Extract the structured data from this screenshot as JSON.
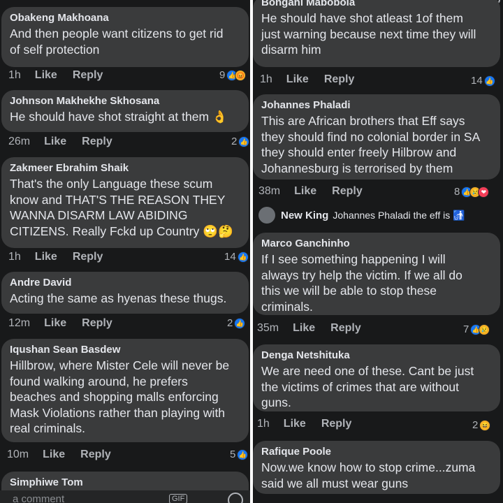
{
  "left": {
    "comments": [
      {
        "author": "Obakeng Makhoana",
        "lines": [
          "And then people want citizens to get rid",
          "of self protection"
        ],
        "time": "1h",
        "like": "Like",
        "reply": "Reply",
        "count": "9",
        "reactions": [
          "like",
          "angry"
        ]
      },
      {
        "author": "Johnson Makhekhe Skhosana",
        "lines": [
          "He should have shot straight at them 👌"
        ],
        "time": "26m",
        "like": "Like",
        "reply": "Reply",
        "count": "2",
        "reactions": [
          "like"
        ]
      },
      {
        "author": "Zakmeer Ebrahim Shaik",
        "lines": [
          "That's the only Language these scum",
          "know and THAT'S THE REASON THEY",
          "WANNA DISARM LAW ABIDING",
          "CITIZENS. Really Fckd up Country 🙄🤔"
        ],
        "time": "1h",
        "like": "Like",
        "reply": "Reply",
        "count": "14",
        "reactions": [
          "like"
        ]
      },
      {
        "author": "Andre David",
        "lines": [
          "Acting the same as hyenas these thugs."
        ],
        "time": "12m",
        "like": "Like",
        "reply": "Reply",
        "count": "2",
        "reactions": [
          "like"
        ]
      },
      {
        "author": "Iqushan Sean Basdew",
        "lines": [
          "Hillbrow, where Mister Cele will never be",
          "found walking around, he prefers",
          "beaches and shopping malls enforcing",
          "Mask Violations rather than playing with",
          "real criminals."
        ],
        "time": "10m",
        "like": "Like",
        "reply": "Reply",
        "count": "5",
        "reactions": [
          "like"
        ]
      },
      {
        "author": "Simphiwe Tom",
        "lines": [],
        "time": "",
        "like": "",
        "reply": "",
        "count": "",
        "reactions": []
      }
    ],
    "composer_placeholder": "a comment",
    "gif_label": "GIF"
  },
  "right": {
    "comments": [
      {
        "author": "Bongani Mabobola",
        "lines": [
          "He should have shot atleast 1of them",
          "just warning because next time they will",
          "disarm him"
        ],
        "time": "1h",
        "like": "Like",
        "reply": "Reply",
        "count": "14",
        "reactions": [
          "like"
        ]
      },
      {
        "author": "Johannes Phaladi",
        "lines": [
          "This are African brothers that Eff says",
          "they should find no colonial border in SA",
          "they should enter freely  Hilbrow and",
          "Johannesburg is terrorised by them"
        ],
        "time": "38m",
        "like": "Like",
        "reply": "Reply",
        "count": "8",
        "reactions": [
          "like",
          "sad",
          "love"
        ]
      },
      {
        "author": "Marco Ganchinho",
        "lines": [
          "If I see something happening I will",
          "always try help the victim. If we all do",
          "this we will be able to stop these",
          "criminals."
        ],
        "time": "35m",
        "like": "Like",
        "reply": "Reply",
        "count": "7",
        "reactions": [
          "like",
          "sad"
        ]
      },
      {
        "author": "Denga Netshituka",
        "lines": [
          "We are need one of these. Cant be just",
          "the victims of crimes that are without",
          "guns."
        ],
        "time": "1h",
        "like": "Like",
        "reply": "Reply",
        "count": "2",
        "reactions": [
          "haha"
        ]
      },
      {
        "author": "Rafique Poole",
        "lines": [
          "Now.we know how to stop crime...zuma",
          "said we all must wear guns"
        ],
        "time": "",
        "like": "",
        "reply": "",
        "count": "",
        "reactions": []
      }
    ],
    "nested_reply": {
      "author": "New King",
      "text": "Johannes Phaladi the eff is 🚮"
    }
  },
  "colors": {
    "bubble": "#3a3b3c",
    "background": "#18191a",
    "like": "#1877f2",
    "meta": "#b0b3b8"
  }
}
